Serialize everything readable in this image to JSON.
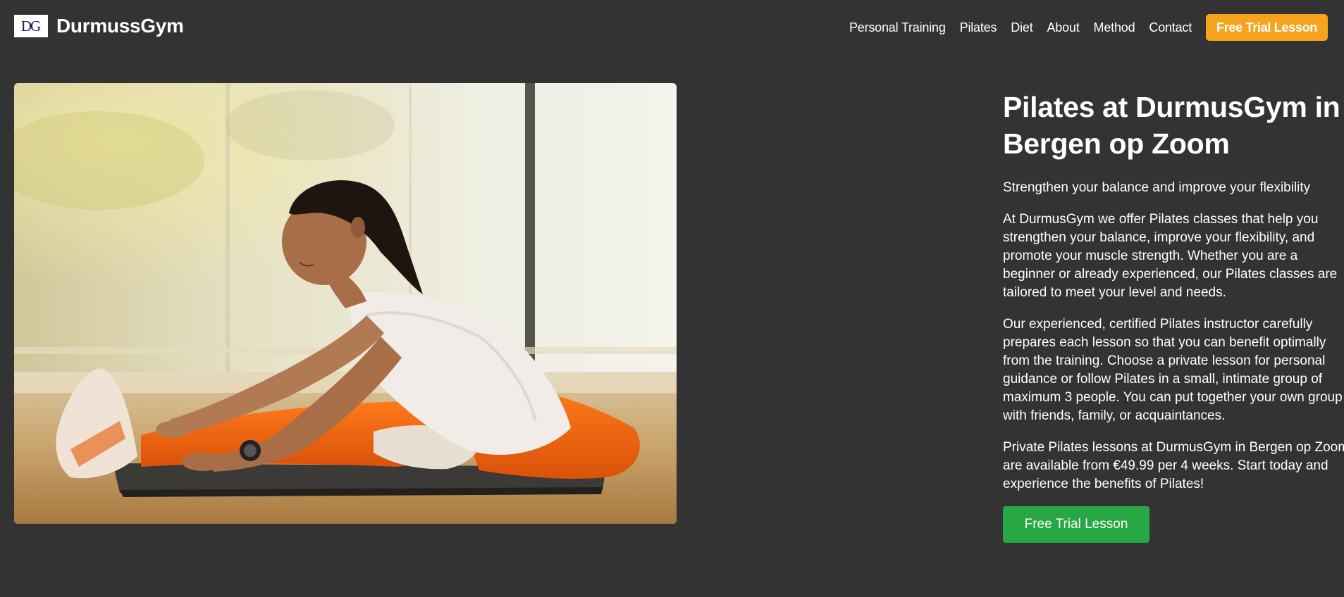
{
  "brand": {
    "logo_text": "DG",
    "name": "DurmussGym"
  },
  "nav": {
    "items": [
      {
        "label": "Personal Training"
      },
      {
        "label": "Pilates"
      },
      {
        "label": "Diet"
      },
      {
        "label": "About"
      },
      {
        "label": "Method"
      },
      {
        "label": "Contact"
      }
    ],
    "cta_label": "Free Trial Lesson"
  },
  "hero": {
    "title_line1": "Pilates at DurmusGym in",
    "title_line2": "Bergen op Zoom",
    "subtitle": "Strengthen your balance and improve your flexibility",
    "paragraph1": [
      "At DurmusGym we offer Pilates classes that help you",
      "strengthen your balance, improve your flexibility, and",
      "promote your muscle strength. Whether you are a",
      "beginner or already experienced, our Pilates classes are",
      "tailored to meet your level and needs."
    ],
    "paragraph2": [
      "Our experienced, certified Pilates instructor carefully",
      "prepares each lesson so that you can benefit optimally",
      "from the training. Choose a private lesson for personal",
      "guidance or follow Pilates in a small, intimate group of",
      "maximum 3 people. You can put together your own group",
      "with friends, family, or acquaintances."
    ],
    "paragraph3": [
      "Private Pilates lessons at DurmusGym in Bergen op Zoom",
      "are available from €49.99 per 4 weeks. Start today and",
      "experience the benefits of Pilates!"
    ],
    "cta_label": "Free Trial Lesson"
  },
  "colors": {
    "background": "#333333",
    "nav_cta": "#f6a31d",
    "hero_cta": "#28a745",
    "text": "#ffffff"
  }
}
